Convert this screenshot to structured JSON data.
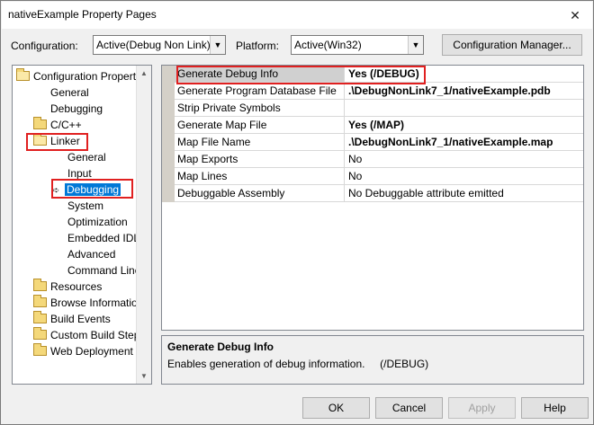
{
  "window": {
    "title": "nativeExample Property Pages",
    "close_glyph": "✕"
  },
  "header": {
    "configuration_label": "Configuration:",
    "configuration_value": "Active(Debug Non Link)",
    "platform_label": "Platform:",
    "platform_value": "Active(Win32)",
    "config_manager_label": "Configuration Manager..."
  },
  "tree": {
    "items": [
      {
        "label": "Configuration Properties",
        "icon": "folder-open-icon"
      },
      {
        "label": "General"
      },
      {
        "label": "Debugging"
      },
      {
        "label": "C/C++",
        "icon": "folder-icon"
      },
      {
        "label": "Linker",
        "icon": "folder-open-icon"
      },
      {
        "label": "General"
      },
      {
        "label": "Input"
      },
      {
        "label": "Debugging",
        "icon": "pointer-icon",
        "selected": true
      },
      {
        "label": "System"
      },
      {
        "label": "Optimization"
      },
      {
        "label": "Embedded IDL"
      },
      {
        "label": "Advanced"
      },
      {
        "label": "Command Line"
      },
      {
        "label": "Resources",
        "icon": "folder-icon"
      },
      {
        "label": "Browse Information",
        "icon": "folder-icon"
      },
      {
        "label": "Build Events",
        "icon": "folder-icon"
      },
      {
        "label": "Custom Build Step",
        "icon": "folder-icon"
      },
      {
        "label": "Web Deployment",
        "icon": "folder-icon"
      }
    ]
  },
  "grid": {
    "rows": [
      {
        "name": "Generate Debug Info",
        "value": "Yes (/DEBUG)",
        "bold": true
      },
      {
        "name": "Generate Program Database File",
        "value": ".\\DebugNonLink7_1/nativeExample.pdb",
        "bold": true
      },
      {
        "name": "Strip Private Symbols",
        "value": ""
      },
      {
        "name": "Generate Map File",
        "value": "Yes (/MAP)",
        "bold": true
      },
      {
        "name": "Map File Name",
        "value": ".\\DebugNonLink7_1/nativeExample.map",
        "bold": true
      },
      {
        "name": "Map Exports",
        "value": "No"
      },
      {
        "name": "Map Lines",
        "value": "No"
      },
      {
        "name": "Debuggable Assembly",
        "value": "No Debuggable attribute emitted"
      }
    ]
  },
  "description": {
    "title": "Generate Debug Info",
    "text": "Enables generation of debug information.     (/DEBUG)"
  },
  "buttons": {
    "ok": "OK",
    "cancel": "Cancel",
    "apply": "Apply",
    "help": "Help"
  },
  "colors": {
    "selection": "#0078d7",
    "highlight_box": "#e02020"
  }
}
